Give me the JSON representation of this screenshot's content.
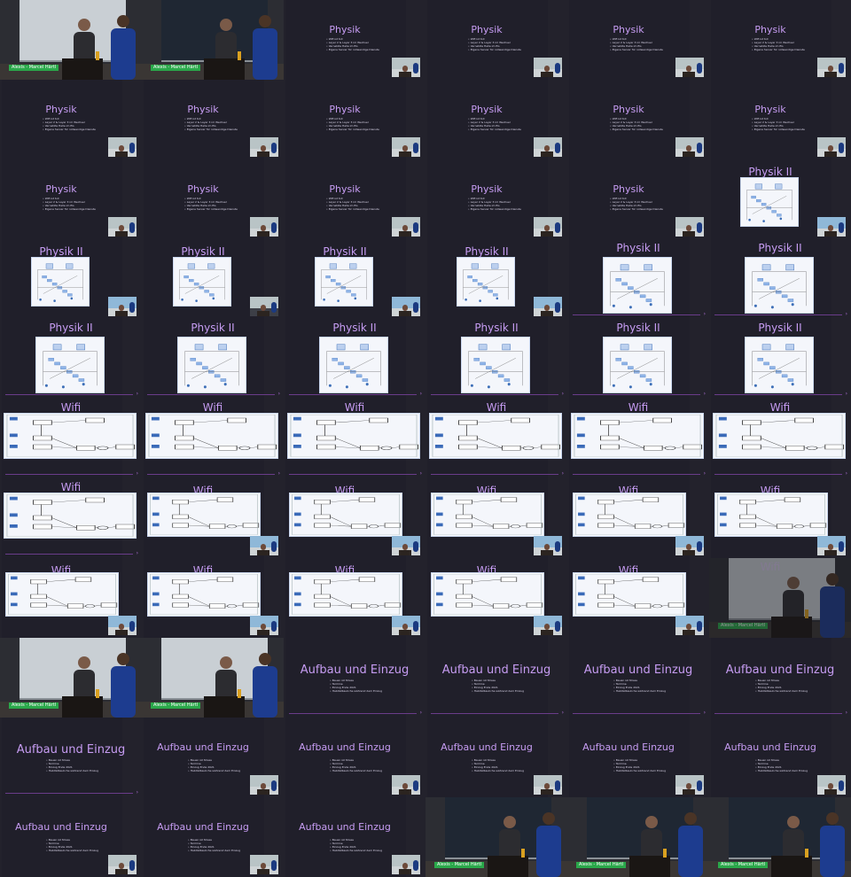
{
  "grid": {
    "tiles": [
      {
        "k": "photo",
        "caption": "",
        "name": "Alexis - Marcel Härtl",
        "variant": "a"
      },
      {
        "k": "photo",
        "caption": "",
        "name": "Alexis - Marcel Härtl",
        "variant": "b"
      },
      {
        "k": "bul",
        "title": "Physik"
      },
      {
        "k": "bul",
        "title": "Physik"
      },
      {
        "k": "bul",
        "title": "Physik"
      },
      {
        "k": "bul",
        "title": "Physik"
      },
      {
        "k": "bul",
        "title": "Physik"
      },
      {
        "k": "bul",
        "title": "Physik"
      },
      {
        "k": "bul",
        "title": "Physik"
      },
      {
        "k": "bul",
        "title": "Physik"
      },
      {
        "k": "bul",
        "title": "Physik"
      },
      {
        "k": "bul",
        "title": "Physik"
      },
      {
        "k": "bul",
        "title": "Physik"
      },
      {
        "k": "bul",
        "title": "Physik"
      },
      {
        "k": "bul",
        "title": "Physik"
      },
      {
        "k": "bul",
        "title": "Physik"
      },
      {
        "k": "bul",
        "title": "Physik"
      },
      {
        "k": "p2s",
        "title": "Physik II",
        "inset": "blue"
      },
      {
        "k": "p2s",
        "title": "Physik II",
        "inset": "blue"
      },
      {
        "k": "p2s",
        "title": "Physik II",
        "inset": ""
      },
      {
        "k": "p2s",
        "title": "Physik II",
        "inset": "blue"
      },
      {
        "k": "p2s",
        "title": "Physik II",
        "inset": "blue"
      },
      {
        "k": "p2l",
        "title": "Physik II"
      },
      {
        "k": "p2l",
        "title": "Physik II"
      },
      {
        "k": "p2l",
        "title": "Physik II"
      },
      {
        "k": "p2l",
        "title": "Physik II"
      },
      {
        "k": "p2l",
        "title": "Physik II"
      },
      {
        "k": "p2l",
        "title": "Physik II"
      },
      {
        "k": "p2l",
        "title": "Physik II"
      },
      {
        "k": "p2l",
        "title": "Physik II"
      },
      {
        "k": "w",
        "title": "Wifi"
      },
      {
        "k": "w",
        "title": "Wifi"
      },
      {
        "k": "w",
        "title": "Wifi"
      },
      {
        "k": "w",
        "title": "Wifi"
      },
      {
        "k": "w",
        "title": "Wifi"
      },
      {
        "k": "w",
        "title": "Wifi"
      },
      {
        "k": "w",
        "title": "Wifi"
      },
      {
        "k": "ws",
        "title": "Wifi",
        "inset": "blue"
      },
      {
        "k": "ws",
        "title": "Wifi",
        "inset": "blue"
      },
      {
        "k": "ws",
        "title": "Wifi",
        "inset": "blue"
      },
      {
        "k": "ws",
        "title": "Wifi",
        "inset": "blue"
      },
      {
        "k": "ws",
        "title": "Wifi",
        "inset": "blue"
      },
      {
        "k": "ws",
        "title": "Wifi",
        "inset": "blue"
      },
      {
        "k": "ws",
        "title": "Wifi",
        "inset": "blue"
      },
      {
        "k": "ws",
        "title": "Wifi",
        "inset": "blue"
      },
      {
        "k": "ws",
        "title": "Wifi",
        "inset": "blue"
      },
      {
        "k": "ws",
        "title": "Wifi",
        "inset": "blue"
      },
      {
        "k": "fade",
        "title": "Wifi",
        "name": "Alexis - Marcel Härtl"
      },
      {
        "k": "photo",
        "caption": "",
        "name": "Alexis - Marcel Härtl",
        "variant": "c"
      },
      {
        "k": "photo",
        "caption": "",
        "name": "Alexis - Marcel Härtl",
        "variant": "d"
      },
      {
        "k": "auf",
        "title": "Aufbau und Einzug",
        "big": true
      },
      {
        "k": "auf",
        "title": "Aufbau und Einzug",
        "big": true
      },
      {
        "k": "auf",
        "title": "Aufbau und Einzug",
        "big": true
      },
      {
        "k": "auf",
        "title": "Aufbau und Einzug",
        "big": true
      },
      {
        "k": "auf",
        "title": "Aufbau und Einzug",
        "big": true
      },
      {
        "k": "auf",
        "title": "Aufbau und Einzug"
      },
      {
        "k": "auf",
        "title": "Aufbau und Einzug"
      },
      {
        "k": "auf",
        "title": "Aufbau und Einzug"
      },
      {
        "k": "auf",
        "title": "Aufbau und Einzug"
      },
      {
        "k": "auf",
        "title": "Aufbau und Einzug"
      },
      {
        "k": "auf",
        "title": "Aufbau und Einzug"
      },
      {
        "k": "auf",
        "title": "Aufbau und Einzug"
      },
      {
        "k": "auf",
        "title": "Aufbau und Einzug"
      },
      {
        "k": "photo",
        "caption": "",
        "name": "Alexis - Marcel Härtl",
        "variant": "e"
      },
      {
        "k": "photo",
        "caption": "",
        "name": "Alexis - Marcel Härtl",
        "variant": "f"
      },
      {
        "k": "photo",
        "caption": "",
        "name": "Alexis - Marcel Härtl",
        "variant": "g"
      }
    ]
  },
  "physik_bullets": [
    "Wifi ist toll",
    "Layer 2 & Layer 3 im Wechsel",
    "Vernetzte Halle im EG",
    "Eigene Server für notwendige Dienste"
  ],
  "aufbau_bullets": [
    "Bauen ist Stress",
    "Termine",
    "Einzug Ende 2021",
    "Habitatbauliche während dem Einzug"
  ],
  "wifi_labels": [
    "DHCP-Server",
    "WiFi Controller",
    "Router",
    "Internet"
  ],
  "colors": {
    "background": "#1a1a1f",
    "slide": "#201f2a",
    "title": "#c69cf2",
    "name_tag": "#2aa84a",
    "accent": "#6a3c8a"
  }
}
